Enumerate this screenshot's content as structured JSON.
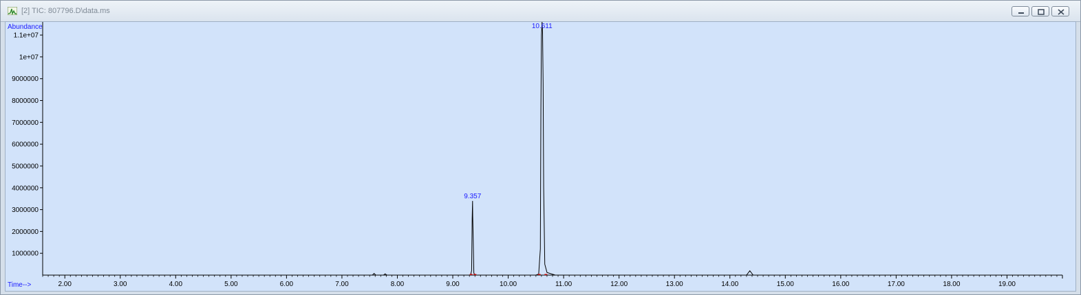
{
  "window": {
    "title": "[2] TIC: 807796.D\\data.ms",
    "icon": "chromatogram-app-icon",
    "controls": [
      "minimize-icon",
      "restore-icon",
      "close-icon"
    ]
  },
  "colors": {
    "plot_background": "#d2e3fa",
    "trace": "#000000",
    "label_blue": "#1a1aff",
    "integration_marker": "#e02020"
  },
  "chart_data": {
    "type": "line",
    "title": "",
    "ylabel": "Abundance",
    "xlabel": "Time-->",
    "xlim": [
      1.6,
      20.0
    ],
    "ylim": [
      0,
      11600000
    ],
    "x_ticks": [
      "2.00",
      "3.00",
      "4.00",
      "5.00",
      "6.00",
      "7.00",
      "8.00",
      "9.00",
      "10.00",
      "11.00",
      "12.00",
      "13.00",
      "14.00",
      "15.00",
      "16.00",
      "17.00",
      "18.00",
      "19.00"
    ],
    "y_ticks": [
      "1000000",
      "2000000",
      "3000000",
      "4000000",
      "5000000",
      "6000000",
      "7000000",
      "8000000",
      "9000000",
      "1e+07",
      "1.1e+07"
    ],
    "peak_labels": [
      {
        "text": "9.357",
        "x": 9.357,
        "y": 3400000
      },
      {
        "text": "10.611",
        "x": 10.611,
        "y": 12000000
      }
    ],
    "series": [
      {
        "x": [
          1.6,
          7.55,
          7.58,
          7.61,
          7.75,
          7.78,
          7.81,
          9.25,
          9.32,
          9.34,
          9.35,
          9.357,
          9.36,
          9.37,
          9.38,
          9.4,
          9.45,
          10.5,
          10.55,
          10.58,
          10.59,
          10.6,
          10.611,
          10.62,
          10.63,
          10.64,
          10.66,
          10.7,
          10.8,
          10.85,
          14.3,
          14.36,
          14.42,
          19.99
        ],
        "y": [
          0,
          0,
          80000,
          0,
          0,
          60000,
          0,
          0,
          0,
          200000,
          2600000,
          3400000,
          2700000,
          1500000,
          100000,
          0,
          0,
          0,
          50000,
          1200000,
          7600000,
          11000000,
          12000000,
          11100000,
          8800000,
          4000000,
          500000,
          120000,
          40000,
          0,
          0,
          200000,
          0,
          0
        ]
      }
    ]
  }
}
